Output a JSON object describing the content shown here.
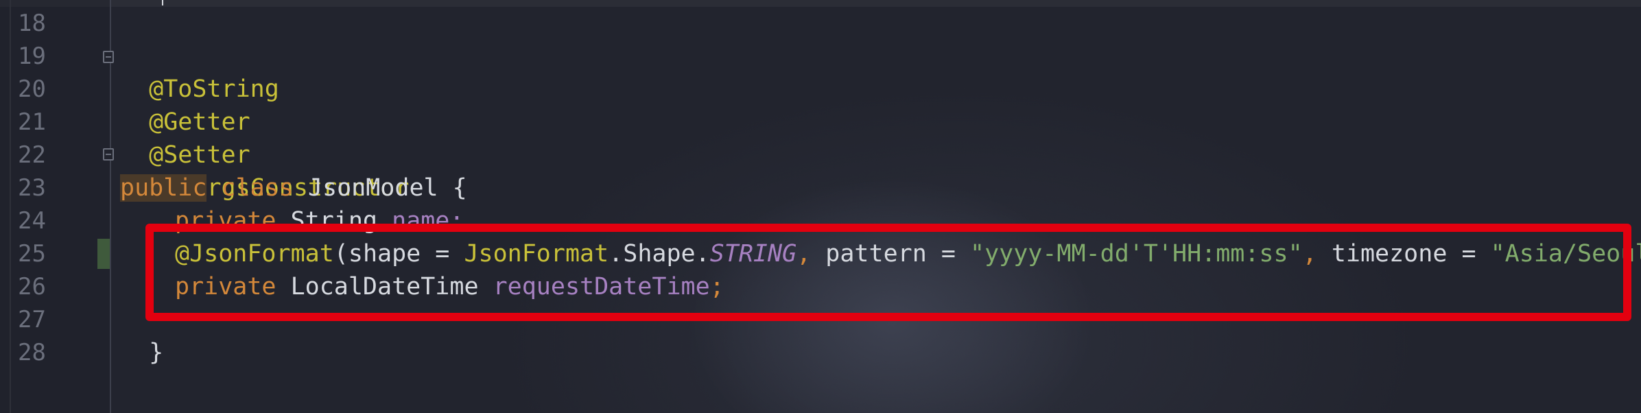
{
  "editor": {
    "line_numbers": [
      "18",
      "19",
      "20",
      "21",
      "22",
      "23",
      "24",
      "25",
      "26",
      "27",
      "28"
    ],
    "lines": {
      "l19": {
        "ann": "@ToString"
      },
      "l20": {
        "ann": "@Getter"
      },
      "l21": {
        "ann": "@Setter"
      },
      "l22": {
        "ann": "@NoArgsConstructor"
      },
      "l23": {
        "kw_public": "public",
        "kw_class": " class ",
        "name": "JsonModel {"
      },
      "l24": {
        "kw_private": "private ",
        "type": "String ",
        "field": "name;"
      },
      "l25": {
        "ann": "@JsonFormat",
        "p1": "(shape = ",
        "cls": "JsonFormat",
        "p2": ".Shape.",
        "const": "STRING",
        "comma1": ", ",
        "p3": "pattern = ",
        "pattern": "\"yyyy-MM-dd'T'HH:mm:ss\"",
        "comma2": ", ",
        "p4": "timezone = ",
        "tz": "\"Asia/Seoul\"",
        "close": ")"
      },
      "l26": {
        "kw_private": "private ",
        "type": "LocalDateTime ",
        "field": "requestDateTime",
        "semi": ";"
      },
      "l27": {
        "brace": "}"
      }
    },
    "colors": {
      "annotation": "#c9c139",
      "keyword": "#d4883a",
      "field": "#a781c2",
      "string": "#82ac6c",
      "highlight_border": "#e3000f"
    }
  }
}
